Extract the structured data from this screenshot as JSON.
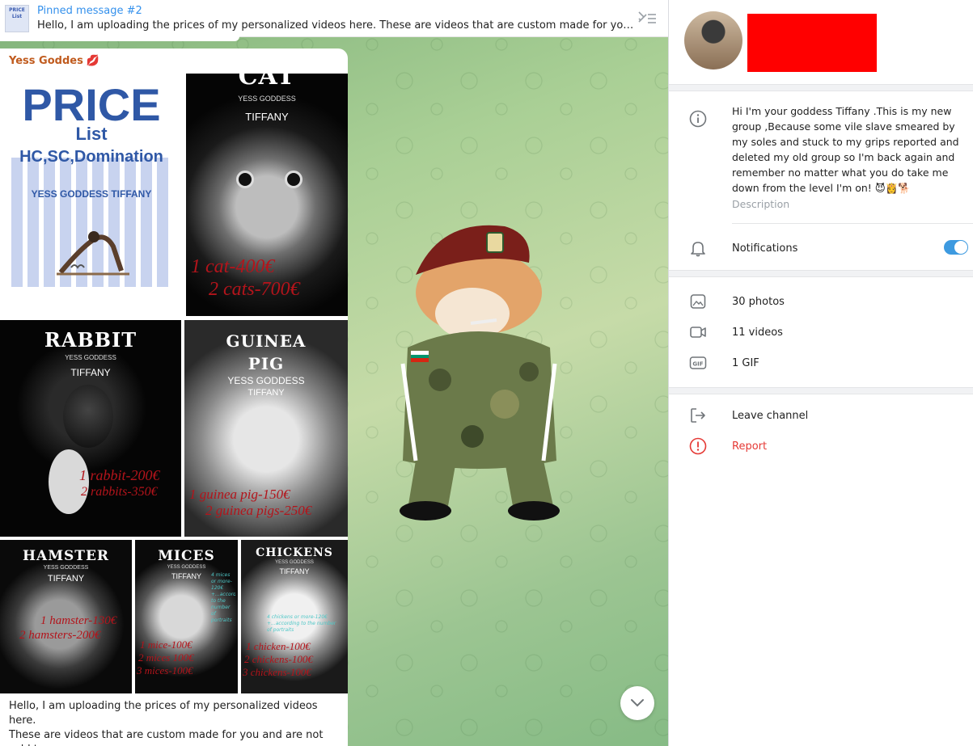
{
  "pinned": {
    "title": "Pinned message #2",
    "preview": "Hello, I am uploading the prices of my personalized videos here.  These are videos that are custom made for you and ar...",
    "thumb_text": "PRICE List"
  },
  "post": {
    "author": "Yess Goddes",
    "author_emoji": "💋",
    "caption_line1": "Hello, I am uploading the prices of my personalized videos here.",
    "caption_line2": "These are videos that are custom made for you and are not sold to",
    "price_list": {
      "title": "PRICE",
      "subtitle": "List",
      "categories": "HC,SC,Domination",
      "brand": "YESS GODDESS TIFFANY"
    },
    "tiles": {
      "cat": {
        "title": "CAT",
        "sub1": "YESS GODDESS",
        "sub2": "TIFFANY",
        "line1": "1 cat-400€",
        "line2": "2 cats-700€"
      },
      "rabbit": {
        "title": "RABBIT",
        "sub1": "YESS GODDESS",
        "sub2": "TIFFANY",
        "line1": "1 rabbit-200€",
        "line2": "2 rabbits-350€"
      },
      "guinea": {
        "title1": "GUINEA",
        "title2": "PIG",
        "sub1": "YESS GODDESS",
        "sub2": "TIFFANY",
        "line1": "1 guinea pig-150€",
        "line2": "2 guinea pigs-250€"
      },
      "hamster": {
        "title": "HAMSTER",
        "sub1": "YESS GODDESS",
        "sub2": "TIFFANY",
        "line1": "1 hamster-130€",
        "line2": "2 hamsters-200€"
      },
      "mices": {
        "title": "MICES",
        "sub1": "YESS GODDESS",
        "sub2": "TIFFANY",
        "line1": "1 mice-100€",
        "line2": "2 mices 100€",
        "line3": "3 mices-100€",
        "note": "4 mices or more-120€ +...according to the number of portraits"
      },
      "chickens": {
        "title": "CHICKENS",
        "sub1": "YESS GODDESS",
        "sub2": "TIFFANY",
        "line1": "1 chicken-100€",
        "line2": "2 chickens-100€",
        "line3": "3 chickens-100€",
        "note": "4 chickens or more-120€ +...according to the number of portraits"
      }
    }
  },
  "panel": {
    "description": "Hi I'm your goddess Tiffany .This is my new group ,Because some vile slave smeared by my soles and stuck to my grips reported and deleted my old group so I'm back again and remember no matter what you do take me down from the level I'm on! 😈👸🐕",
    "description_label": "Description",
    "notifications_label": "Notifications",
    "notifications_on": true,
    "media": {
      "photos": "30 photos",
      "videos": "11 videos",
      "gifs": "1 GIF"
    },
    "leave_label": "Leave channel",
    "report_label": "Report"
  },
  "colors": {
    "accent": "#3390ec",
    "author": "#c05b1e",
    "report": "#e53935",
    "toggle": "#3d9ae0",
    "redaction": "#ff0000"
  },
  "icons": {
    "pin_list": "pin-list-icon",
    "info": "info-icon",
    "bell": "bell-icon",
    "photo": "photo-icon",
    "video": "video-icon",
    "gif": "gif-icon",
    "leave": "leave-icon",
    "report": "report-icon",
    "scroll_down": "chevron-down-icon"
  }
}
